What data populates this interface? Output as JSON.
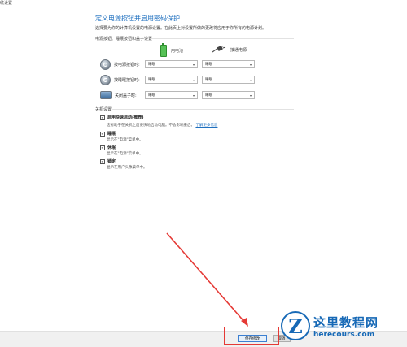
{
  "window": {
    "title": "统设置"
  },
  "page": {
    "heading": "定义电源按钮并启用密码保护",
    "description": "选择要为你的计算机设置的电源设置。在此页上对设置所做的更改将应用于你所有的电源计划。"
  },
  "power_buttons": {
    "section_label": "电源按钮、睡眠按钮和盖子设置",
    "columns": {
      "battery": "用电池",
      "plugged": "接通电源"
    },
    "rows": [
      {
        "label": "按电源按钮时:",
        "battery_value": "睡眠",
        "plugged_value": "睡眠",
        "icon": "power-button-icon"
      },
      {
        "label": "按睡眠按钮时:",
        "battery_value": "睡眠",
        "plugged_value": "睡眠",
        "icon": "sleep-button-icon"
      },
      {
        "label": "关闭盖子时:",
        "battery_value": "睡眠",
        "plugged_value": "睡眠",
        "icon": "laptop-lid-icon"
      }
    ]
  },
  "shutdown": {
    "section_label": "关机设置",
    "options": [
      {
        "label": "启用快速启动(推荐)",
        "desc": "这有助于在关机之后更快地启动电脑。不会影响重启。",
        "link": "了解更多信息",
        "checked": "✓"
      },
      {
        "label": "睡眠",
        "desc": "显示在\"电源\"菜单中。",
        "checked": "✓"
      },
      {
        "label": "休眠",
        "desc": "显示在\"电源\"菜单中。",
        "checked": "✓"
      },
      {
        "label": "锁定",
        "desc": "显示在用户头像菜单中。",
        "checked": "✓"
      }
    ]
  },
  "footer": {
    "save_label": "保存修改",
    "cancel_label": "取消"
  },
  "watermark": {
    "cn": "这里教程网",
    "en": "herecours.com"
  },
  "colors": {
    "accent": "#1e6fbf",
    "highlight": "#e53935",
    "watermark": "#1769b6"
  }
}
